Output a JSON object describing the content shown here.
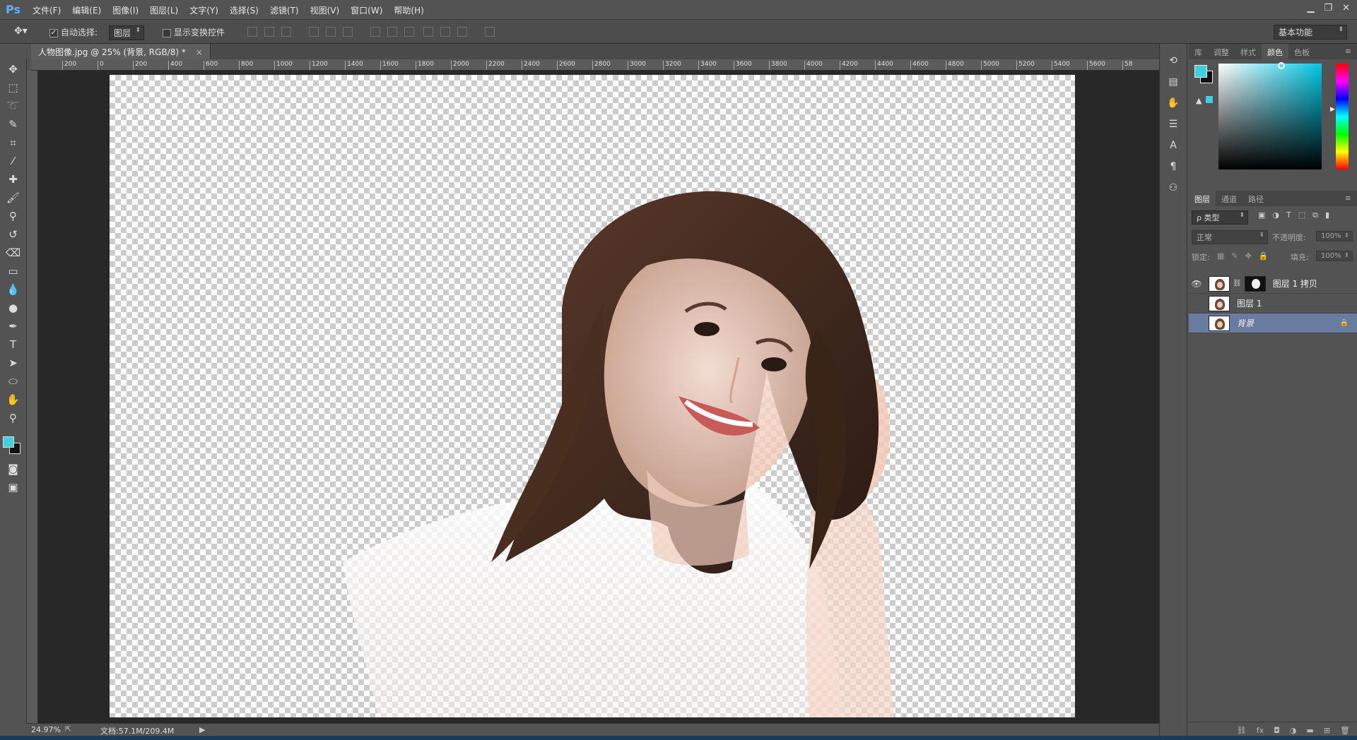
{
  "app": {
    "logo": "Ps"
  },
  "menu": [
    "文件(F)",
    "编辑(E)",
    "图像(I)",
    "图层(L)",
    "文字(Y)",
    "选择(S)",
    "滤镜(T)",
    "视图(V)",
    "窗口(W)",
    "帮助(H)"
  ],
  "options": {
    "auto_select_label": "自动选择:",
    "auto_select_value": "图层",
    "show_transform_label": "显示变换控件",
    "workspace": "基本功能"
  },
  "document_tab": {
    "title": "人物图像.jpg @ 25% (背景, RGB/8) *",
    "close": "×"
  },
  "ruler_h": [
    "200",
    "0",
    "200",
    "400",
    "600",
    "800",
    "1000",
    "1200",
    "1400",
    "1600",
    "1800",
    "2000",
    "2200",
    "2400",
    "2600",
    "2800",
    "3000",
    "3200",
    "3400",
    "3600",
    "3800",
    "4000",
    "4200",
    "4400",
    "4600",
    "4800",
    "5000",
    "5200",
    "5400",
    "5600",
    "58"
  ],
  "status": {
    "zoom": "24.97%",
    "doc": "文档:57.1M/209.4M"
  },
  "color_panel": {
    "tabs": [
      "库",
      "调整",
      "样式",
      "颜色",
      "色板"
    ],
    "active_tab": "颜色",
    "fg_color": "#3fd0e0",
    "bg_color": "#111111"
  },
  "layers_panel": {
    "tabs": [
      "图层",
      "通道",
      "路径"
    ],
    "active_tab": "图层",
    "filter_label": "ρ 类型",
    "blend_mode": "正常",
    "opacity_label": "不透明度:",
    "opacity_value": "100%",
    "lock_label": "锁定:",
    "fill_label": "填充:",
    "fill_value": "100%",
    "layers": [
      {
        "name": "图层 1 拷贝",
        "visible": true,
        "has_mask": true,
        "selected": false
      },
      {
        "name": "图层 1",
        "visible": false,
        "has_mask": false,
        "selected": false
      },
      {
        "name": "背景",
        "visible": false,
        "has_mask": false,
        "selected": true,
        "locked": true
      }
    ]
  }
}
